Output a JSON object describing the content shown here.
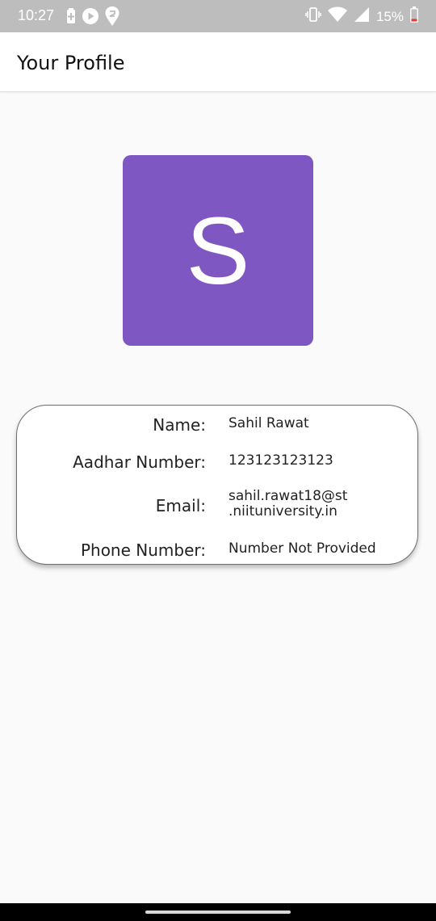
{
  "status_bar": {
    "time": "10:27",
    "battery_percent": "15%",
    "icons_left": [
      "battery-saver-icon",
      "play-icon",
      "swiggy-icon"
    ],
    "icons_right": [
      "vibrate-icon",
      "wifi-icon",
      "signal-icon",
      "battery-low-icon"
    ]
  },
  "app_bar": {
    "title": "Your Profile"
  },
  "avatar": {
    "letter": "S",
    "color": "#7e57c2"
  },
  "profile": {
    "name_label": "Name:",
    "name_value": "Sahil Rawat",
    "aadhar_label": "Aadhar Number:",
    "aadhar_value": "123123123123",
    "email_label": "Email:",
    "email_value_line1": "sahil.rawat18@st",
    "email_value_line2": ".niituniversity.in",
    "phone_label": "Phone Number:",
    "phone_value": "Number Not Provided"
  }
}
